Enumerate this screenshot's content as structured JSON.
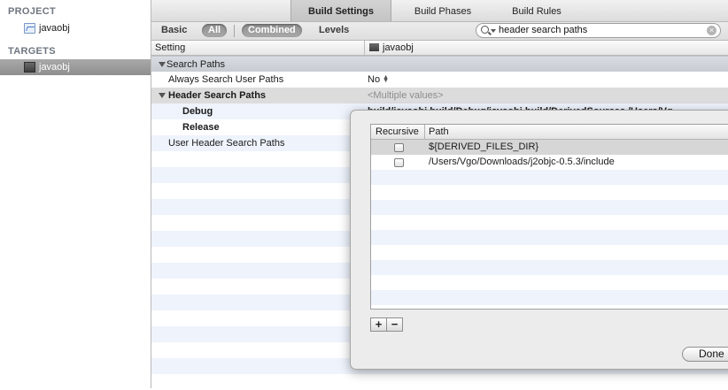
{
  "sidebar": {
    "project_header": "PROJECT",
    "project_item": "javaobj",
    "targets_header": "TARGETS",
    "target_item": "javaobj"
  },
  "tabs": [
    "Build Settings",
    "Build Phases",
    "Build Rules"
  ],
  "filter": {
    "basic": "Basic",
    "all": "All",
    "combined": "Combined",
    "levels": "Levels",
    "search_value": "header search paths"
  },
  "columns": {
    "setting": "Setting",
    "target": "javaobj"
  },
  "rows": {
    "search_paths_group": "Search Paths",
    "always_search_label": "Always Search User Paths",
    "always_search_value": "No",
    "header_search_label": "Header Search Paths",
    "header_search_value": "<Multiple values>",
    "debug_label": "Debug",
    "debug_value": "build/javaobj.build/Debug/javaobj.build/DerivedSources /Users/Vg",
    "release_label": "Release",
    "user_header_label": "User Header Search Paths"
  },
  "popover": {
    "col_recursive": "Recursive",
    "col_path": "Path",
    "paths": [
      {
        "path": "${DERIVED_FILES_DIR}",
        "recursive": false,
        "selected": true
      },
      {
        "path": "/Users/Vgo/Downloads/j2objc-0.5.3/include",
        "recursive": false,
        "selected": false
      }
    ],
    "add_label": "+",
    "remove_label": "−",
    "done_label": "Done"
  },
  "colors": {
    "row_alt": "#eef3fc",
    "selection_gray": "#d6d6d6",
    "muted_text": "#8d8d8d"
  },
  "icons": [
    "project-file-icon",
    "target-icon",
    "search-icon",
    "clear-search-icon",
    "disclosure-triangle-icon",
    "stepper-icon"
  ]
}
